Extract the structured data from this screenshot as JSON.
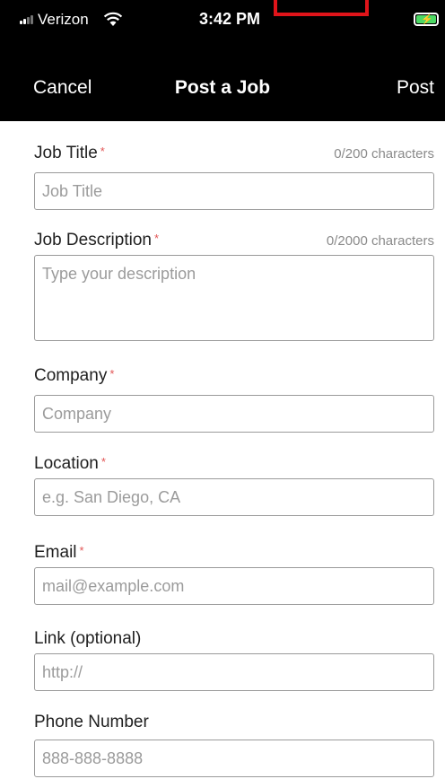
{
  "status_bar": {
    "carrier": "Verizon",
    "time": "3:42 PM",
    "battery": "charging"
  },
  "nav": {
    "cancel_label": "Cancel",
    "title": "Post a Job",
    "post_label": "Post"
  },
  "form": {
    "job_title": {
      "label": "Job Title",
      "required": "*",
      "counter": "0/200 characters",
      "placeholder": "Job Title",
      "value": ""
    },
    "job_description": {
      "label": "Job Description",
      "required": "*",
      "counter": "0/2000 characters",
      "placeholder": "Type your description",
      "value": ""
    },
    "company": {
      "label": "Company",
      "required": "*",
      "placeholder": "Company",
      "value": ""
    },
    "location": {
      "label": "Location",
      "required": "*",
      "placeholder": "e.g. San Diego, CA",
      "value": ""
    },
    "email": {
      "label": "Email",
      "required": "*",
      "placeholder": "mail@example.com",
      "value": ""
    },
    "link": {
      "label": "Link (optional)",
      "placeholder": "http://",
      "value": ""
    },
    "phone": {
      "label": "Phone Number",
      "placeholder": "888-888-8888",
      "value": ""
    }
  },
  "colors": {
    "nav_background": "#000000",
    "required_marker": "#e25555",
    "battery_fill": "#4cd964",
    "highlight_box": "#e0141a"
  }
}
